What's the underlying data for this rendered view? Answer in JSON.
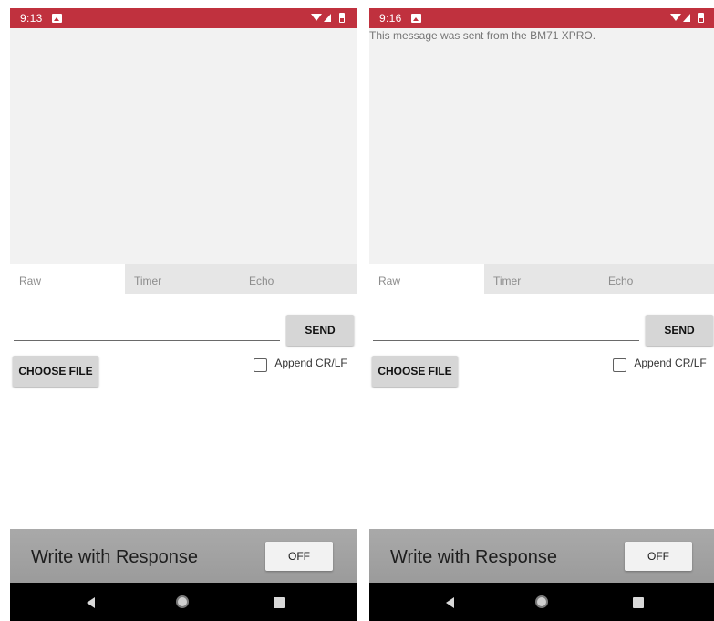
{
  "screens": [
    {
      "status": {
        "time": "9:13"
      },
      "output": {
        "text": ""
      },
      "tabs": [
        {
          "label": "Raw",
          "active": true
        },
        {
          "label": "Timer",
          "active": false
        },
        {
          "label": "Echo",
          "active": false
        }
      ],
      "input": {
        "value": ""
      },
      "send_label": "SEND",
      "choose_file_label": "CHOOSE FILE",
      "append": {
        "label": "Append CR/LF",
        "checked": false
      },
      "response": {
        "label": "Write with Response",
        "toggle_label": "OFF"
      }
    },
    {
      "status": {
        "time": "9:16"
      },
      "output": {
        "text": "This message was sent from the BM71 XPRO."
      },
      "tabs": [
        {
          "label": "Raw",
          "active": true
        },
        {
          "label": "Timer",
          "active": false
        },
        {
          "label": "Echo",
          "active": false
        }
      ],
      "input": {
        "value": ""
      },
      "send_label": "SEND",
      "choose_file_label": "CHOOSE FILE",
      "append": {
        "label": "Append CR/LF",
        "checked": false
      },
      "response": {
        "label": "Write with Response",
        "toggle_label": "OFF"
      }
    }
  ],
  "colors": {
    "status_bar": "#c0313e",
    "output_background": "#f2f2f2",
    "response_bar": "#a5a5a5",
    "nav_bar": "#000000"
  },
  "icons": {
    "status": [
      "image-notification-icon",
      "wifi-icon",
      "cell-signal-icon",
      "battery-icon"
    ],
    "nav": [
      "back-icon",
      "home-icon",
      "recents-icon"
    ]
  }
}
